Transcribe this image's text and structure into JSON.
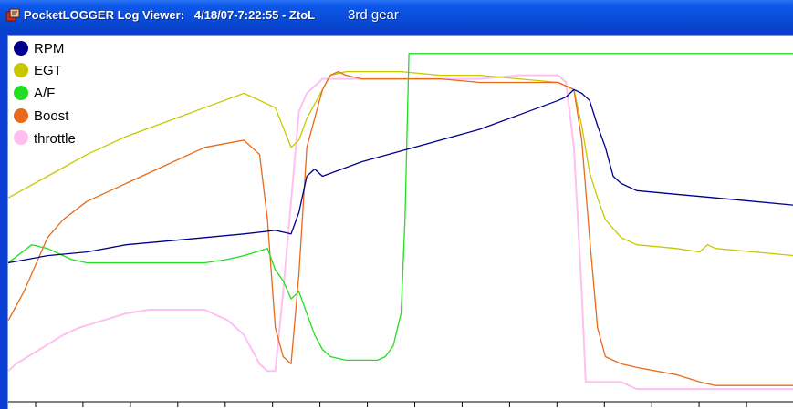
{
  "window": {
    "title": "PocketLOGGER Log Viewer:   4/18/07-7:22:55 - ZtoL",
    "subtitle": "3rd gear"
  },
  "colors": {
    "titlebar": "#0a4fdc",
    "frame": "#0a3fd6",
    "rpm": "#00008b",
    "egt": "#c8c800",
    "af": "#22dd22",
    "boost": "#e86a1a",
    "throttle": "#ffc0f0"
  },
  "legend": [
    {
      "label": "RPM",
      "color": "#00008b"
    },
    {
      "label": "EGT",
      "color": "#c8c800"
    },
    {
      "label": "A/F",
      "color": "#22dd22"
    },
    {
      "label": "Boost",
      "color": "#e86a1a"
    },
    {
      "label": "throttle",
      "color": "#ffc0f0"
    }
  ],
  "chart_data": {
    "type": "line",
    "grid": false,
    "legend_position": "top-left",
    "x_ticks": 16,
    "ylim": [
      0,
      100
    ],
    "xlim": [
      0,
      100
    ],
    "series": [
      {
        "name": "RPM",
        "color": "#00008b",
        "x": [
          0,
          5,
          10,
          15,
          20,
          25,
          30,
          34,
          36,
          37,
          38,
          39,
          40,
          45,
          50,
          55,
          60,
          65,
          70,
          71,
          72,
          73,
          74,
          75,
          76,
          77,
          78,
          80,
          85,
          90,
          95,
          100
        ],
        "y": [
          38,
          40,
          41,
          43,
          44,
          45,
          46,
          47,
          46,
          52,
          62,
          64,
          62,
          66,
          69,
          72,
          75,
          79,
          83,
          84,
          86,
          85,
          83,
          76,
          70,
          62,
          60,
          58,
          57,
          56,
          55,
          54
        ]
      },
      {
        "name": "EGT",
        "color": "#c8c800",
        "x": [
          0,
          5,
          10,
          15,
          20,
          25,
          30,
          34,
          36,
          37,
          38,
          40,
          41,
          43,
          45,
          50,
          55,
          60,
          65,
          70,
          72,
          73,
          74,
          75,
          76,
          78,
          80,
          85,
          88,
          89,
          90,
          95,
          100
        ],
        "y": [
          56,
          62,
          68,
          73,
          77,
          81,
          85,
          81,
          70,
          72,
          78,
          86,
          90,
          91,
          91,
          91,
          90,
          90,
          89,
          88,
          86,
          76,
          63,
          56,
          50,
          45,
          43,
          42,
          41,
          43,
          42,
          41,
          40
        ]
      },
      {
        "name": "A/F",
        "color": "#22dd22",
        "x": [
          0,
          3,
          5,
          8,
          10,
          15,
          20,
          25,
          28,
          30,
          33,
          34,
          35,
          36,
          37,
          38,
          39,
          40,
          41,
          43,
          45,
          47,
          48,
          49,
          50,
          50.5,
          51,
          52,
          60,
          70,
          80,
          90,
          100
        ],
        "y": [
          38,
          43,
          42,
          39,
          38,
          38,
          38,
          38,
          39,
          40,
          42,
          36,
          33,
          28,
          30,
          24,
          18,
          14,
          12,
          11,
          11,
          11,
          12,
          15,
          24,
          50,
          96,
          96,
          96,
          96,
          96,
          96,
          96
        ]
      },
      {
        "name": "Boost",
        "color": "#e86a1a",
        "x": [
          0,
          2,
          5,
          7,
          10,
          15,
          20,
          25,
          30,
          32,
          33,
          34,
          35,
          36,
          37,
          38,
          40,
          41,
          42,
          43,
          45,
          50,
          55,
          60,
          65,
          70,
          72,
          73,
          74,
          75,
          76,
          78,
          80,
          85,
          88,
          90,
          95,
          100
        ],
        "y": [
          22,
          30,
          45,
          50,
          55,
          60,
          65,
          70,
          72,
          68,
          50,
          20,
          12,
          10,
          35,
          70,
          86,
          90,
          91,
          90,
          89,
          89,
          89,
          88,
          88,
          88,
          86,
          72,
          45,
          20,
          12,
          10,
          9,
          7,
          5,
          4,
          4,
          4
        ]
      },
      {
        "name": "throttle",
        "color": "#ffc0f0",
        "x": [
          0,
          1,
          4,
          7,
          9,
          12,
          15,
          18,
          20,
          25,
          28,
          30,
          32,
          33,
          34,
          35,
          36,
          37,
          38,
          40,
          41,
          45,
          50,
          55,
          60,
          65,
          70,
          71,
          72,
          73,
          73.5,
          74,
          75,
          78,
          80,
          85,
          90,
          95,
          100
        ],
        "y": [
          8,
          10,
          14,
          18,
          20,
          22,
          24,
          25,
          25,
          25,
          22,
          18,
          10,
          8,
          8,
          30,
          55,
          80,
          85,
          89,
          89,
          89,
          89,
          89,
          89,
          90,
          90,
          88,
          70,
          30,
          5,
          5,
          5,
          5,
          3,
          3,
          3,
          3,
          3
        ]
      }
    ]
  }
}
